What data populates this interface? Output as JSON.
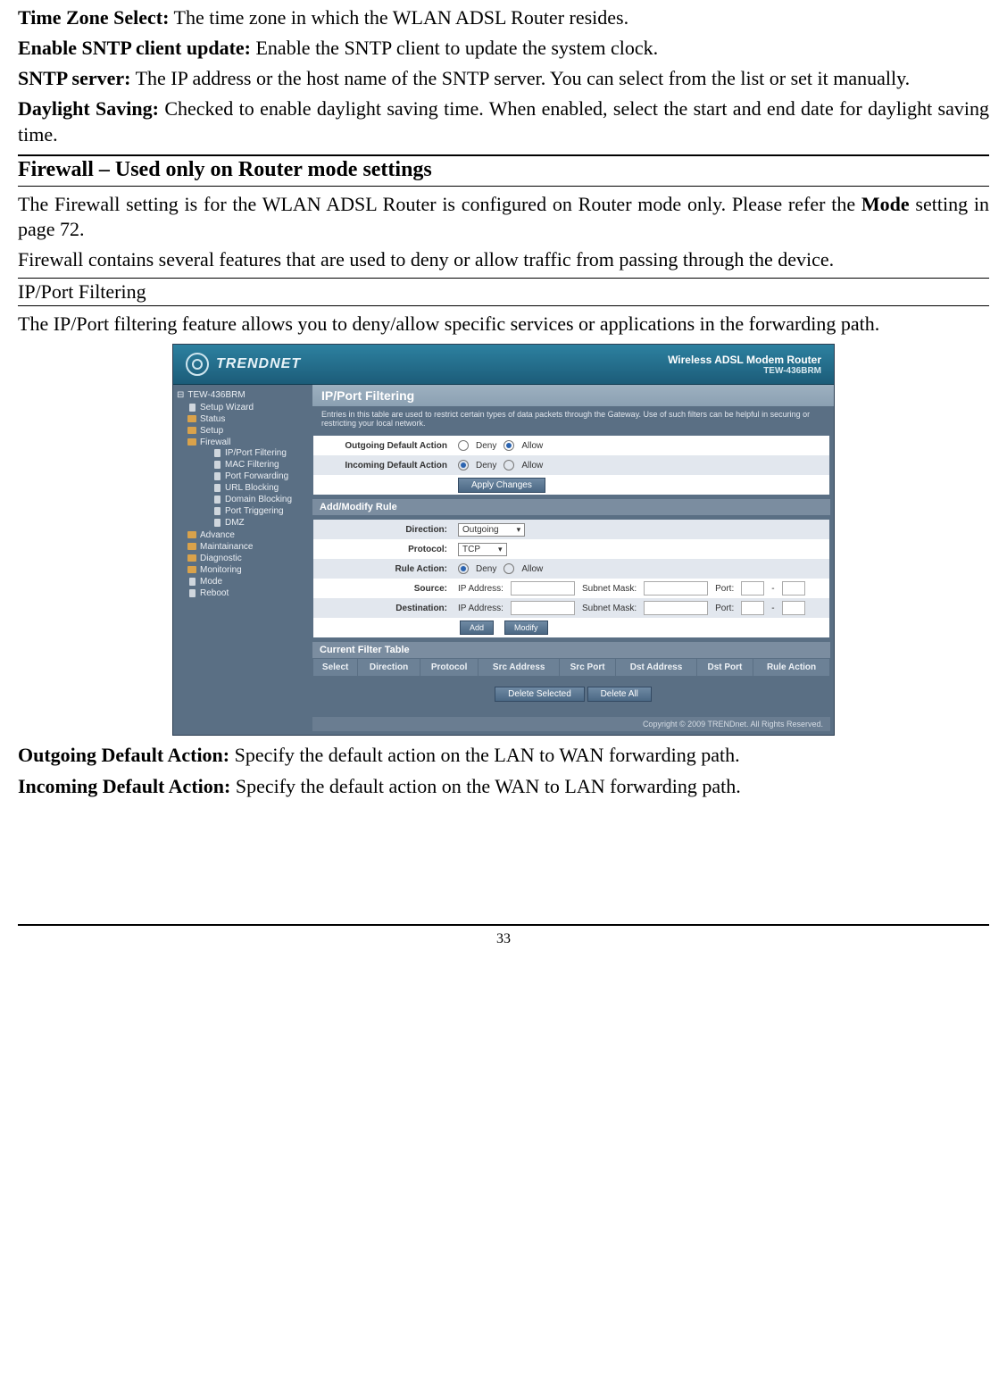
{
  "defs": {
    "tz": {
      "label": "Time Zone Select:",
      "text": "  The time zone in which the WLAN ADSL Router resides."
    },
    "sntpEnable": {
      "label": "Enable SNTP client update:",
      "text": "  Enable the SNTP client to update the system clock."
    },
    "sntpServer": {
      "label": "SNTP server:",
      "text": "  The IP address or the host name of the SNTP server. You can select from the list or set it manually."
    },
    "daylight": {
      "label": "Daylight Saving:",
      "text": " Checked to enable daylight saving time. When enabled, select the start and end date for daylight saving time."
    }
  },
  "h2": "Firewall – Used only on Router mode settings",
  "fw1_a": "The Firewall setting is for the WLAN ADSL Router is configured on Router mode only. Please refer the ",
  "fw1_b": "Mode",
  "fw1_c": " setting in page 72.",
  "fw2": "Firewall contains several features that are used to deny or allow traffic from passing through the device.",
  "h3": "IP/Port Filtering",
  "ipf": "The IP/Port filtering feature allows you to deny/allow specific services or applications in the forwarding path.",
  "out": {
    "label": "Outgoing Default Action:",
    "text": " Specify the default action on the LAN to WAN forwarding path."
  },
  "in": {
    "label": "Incoming Default Action:",
    "text": " Specify the default action on the WAN to LAN forwarding path."
  },
  "page": "33",
  "shot": {
    "brand": "TRENDNET",
    "prod1": "Wireless ADSL Modem Router",
    "prod2": "TEW-436BRM",
    "nav": {
      "root": "TEW-436BRM",
      "items": [
        "Setup Wizard",
        "Status",
        "Setup",
        "Firewall"
      ],
      "fw": [
        "IP/Port Filtering",
        "MAC Filtering",
        "Port Forwarding",
        "URL Blocking",
        "Domain Blocking",
        "Port Triggering",
        "DMZ"
      ],
      "rest": [
        "Advance",
        "Maintainance",
        "Diagnostic",
        "Monitoring",
        "Mode",
        "Reboot"
      ]
    },
    "title": "IP/Port Filtering",
    "desc": "Entries in this table are used to restrict certain types of data packets through the Gateway. Use of such filters can be helpful in securing or restricting your local network.",
    "rows": {
      "outLabel": "Outgoing Default Action",
      "inLabel": "Incoming Default Action",
      "deny": "Deny",
      "allow": "Allow",
      "apply": "Apply Changes"
    },
    "sectAdd": "Add/Modify Rule",
    "form": {
      "direction": "Direction:",
      "directionVal": "Outgoing",
      "protocol": "Protocol:",
      "protocolVal": "TCP",
      "ruleAction": "Rule Action:",
      "source": "Source:",
      "destination": "Destination:",
      "ip": "IP Address:",
      "mask": "Subnet Mask:",
      "port": "Port:",
      "dash": "-",
      "add": "Add",
      "modify": "Modify"
    },
    "sectTable": "Current Filter Table",
    "th": {
      "select": "Select",
      "direction": "Direction",
      "protocol": "Protocol",
      "src": "Src Address",
      "srcp": "Src Port",
      "dst": "Dst Address",
      "dstp": "Dst Port",
      "ra": "Rule Action"
    },
    "btns": {
      "delSel": "Delete Selected",
      "delAll": "Delete All"
    },
    "foot": "Copyright © 2009 TRENDnet. All Rights Reserved."
  }
}
